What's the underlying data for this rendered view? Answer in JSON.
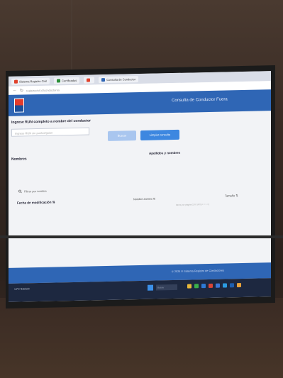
{
  "browser": {
    "tabs": [
      {
        "label": "Sistema Registro Civil"
      },
      {
        "label": "Certificados"
      },
      {
        "label": ""
      },
      {
        "label": "Consulta de Conductor"
      }
    ],
    "url": "registrocivil.cl/conductores"
  },
  "app": {
    "title": "Consulta de Conductor Fuera",
    "colors": {
      "header": "#2f66b5",
      "button_primary": "#3d87e0",
      "button_disabled": "#a9c6ef"
    }
  },
  "form": {
    "section_title": "Ingrese RUN completo a nombre del conductor",
    "rut_placeholder": "Ingrese RUN sin puntos/guion",
    "search_button": "Buscar",
    "clear_button": "Limpiar consulta"
  },
  "labels": {
    "nombres": "Nombres",
    "apellidos": "Apellidos y nombres"
  },
  "filter": {
    "text": "Filtrar por nombre"
  },
  "table": {
    "headers": [
      "Fecha de modificación ⇅",
      "Nombre archivo ⇅",
      "Tamaño ⇅"
    ],
    "pagination": "Items por página 10   0 of 0   |<  <  >  >|"
  },
  "footer": {
    "text": "© 2024 ® Sistema Registro de Conductores"
  },
  "taskbar": {
    "weather": "14°C Nublado",
    "search_label": "Buscar"
  }
}
